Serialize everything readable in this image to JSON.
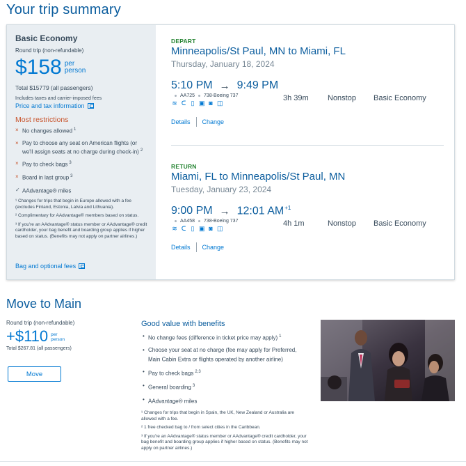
{
  "page": {
    "title": "Your trip summary"
  },
  "fare": {
    "name": "Basic Economy",
    "trip_type": "Round trip (non-refundable)",
    "price": "$158",
    "per_person": [
      "per",
      "person"
    ],
    "total": "Total $15779 (all passengers)",
    "fees_note": "Includes taxes and carrier-imposed fees",
    "price_tax_link": "Price and tax information",
    "restrictions_title": "Most restrictions",
    "restrictions": [
      {
        "mark": "×",
        "text": "No changes allowed",
        "sup": "1"
      },
      {
        "mark": "×",
        "text": "Pay to choose any seat on American flights (or we'll assign seats at no charge during check-in)",
        "sup": "2"
      },
      {
        "mark": "×",
        "text": "Pay to check bags",
        "sup": "3"
      },
      {
        "mark": "×",
        "text": "Board in last group",
        "sup": "3"
      },
      {
        "mark": "✓",
        "text": "AAdvantage® miles",
        "sup": ""
      }
    ],
    "footnotes": [
      "¹ Changes for trips that begin in Europe allowed with a fee (excludes Finland, Estonia, Latvia and Lithuania).",
      "² Complimentary for AAdvantage® members based on status.",
      "³ If you're an AAdvantage® status member or AAdvantage® credit cardholder, your bag benefit and boarding group applies if higher based on status. (Benefits may not apply on partner airlines.)"
    ],
    "bag_fees_link": "Bag and optional fees"
  },
  "depart": {
    "tag": "DEPART",
    "route": "Minneapolis/St Paul, MN to Miami, FL",
    "date": "Thursday, January 18, 2024",
    "dep_time": "5:10 PM",
    "arrow": "→",
    "arr_time": "9:49 PM",
    "arr_sup": "",
    "duration": "3h 39m",
    "stops": "Nonstop",
    "cabin": "Basic Economy",
    "flight": "AA725",
    "aircraft": "738-Boeing 737",
    "details": "Details",
    "change": "Change"
  },
  "return": {
    "tag": "RETURN",
    "route": "Miami, FL to Minneapolis/St Paul, MN",
    "date": "Tuesday, January 23, 2024",
    "dep_time": "9:00 PM",
    "arrow": "→",
    "arr_time": "12:01 AM",
    "arr_sup": "+1",
    "duration": "4h 1m",
    "stops": "Nonstop",
    "cabin": "Basic Economy",
    "flight": "AA458",
    "aircraft": "738-Boeing 737",
    "details": "Details",
    "change": "Change"
  },
  "amenities": [
    "wifi-icon",
    "power-outlet-icon",
    "usb-icon",
    "entertainment-icon",
    "movie-icon",
    "snack-icon"
  ],
  "upgrade": {
    "title": "Move to Main",
    "trip_type": "Round trip (non-refundable)",
    "price": "+$110",
    "per_person": [
      "per",
      "person"
    ],
    "total": "Total $267.81 (all passengers)",
    "button": "Move",
    "benefits_title": "Good value with benefits",
    "benefits": [
      {
        "text": "No change fees (difference in ticket price may apply)",
        "sup": "1"
      },
      {
        "text": "Choose your seat at no charge (fee may apply for Preferred, Main Cabin Extra or flights operated by another airline)",
        "sup": ""
      },
      {
        "text": "Pay to check bags",
        "sup": "2,3"
      },
      {
        "text": "General boarding",
        "sup": "3"
      },
      {
        "text": "AAdvantage® miles",
        "sup": ""
      }
    ],
    "footnotes": [
      "¹ Changes for trips that begin in Spain, the UK, New Zealand or Australia are allowed with a fee.",
      "² 1 free checked bag to / from select cities in the Caribbean.",
      "³ If you're an AAdvantage® status member or AAdvantage® credit cardholder, your bag benefit and boarding group applies if higher based on status. (Benefits may not apply on partner airlines.)"
    ]
  }
}
